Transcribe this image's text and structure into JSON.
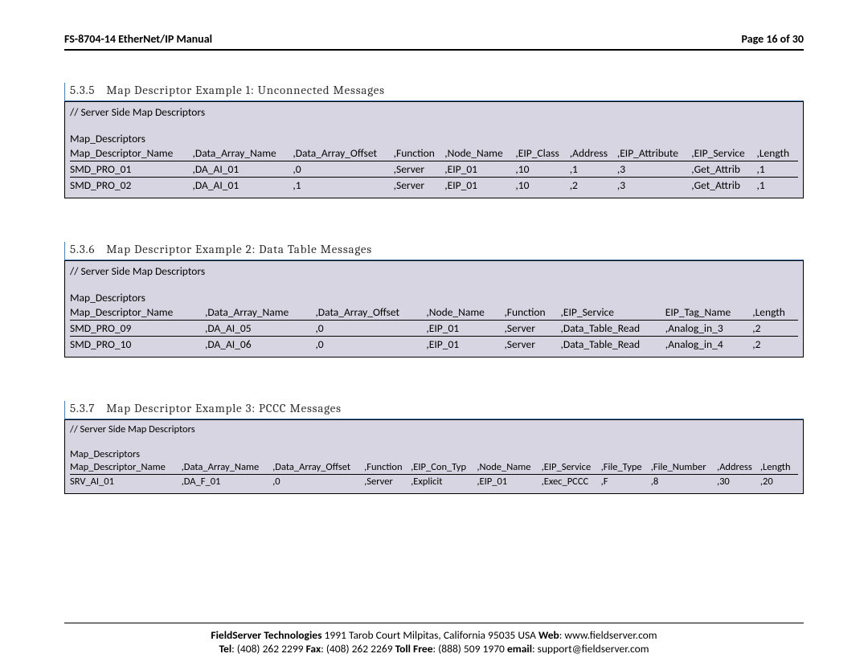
{
  "header": {
    "title": "FS-8704-14 EtherNet/IP Manual",
    "page": "Page 16 of 30"
  },
  "sections": [
    {
      "num": "5.3.5",
      "title": "Map Descriptor Example 1: Unconnected Messages",
      "comment": "// Server Side Map Descriptors",
      "label": "Map_Descriptors",
      "cols": [
        "Map_Descriptor_Name",
        ",Data_Array_Name",
        ",Data_Array_Offset",
        ",Function",
        ",Node_Name",
        ",EIP_Class",
        ",Address",
        ",EIP_Attribute",
        ",EIP_Service",
        ",Length"
      ],
      "rows": [
        [
          "SMD_PRO_01",
          ",DA_AI_01",
          ",0",
          ",Server",
          ",EIP_01",
          ",10",
          ",1",
          ",3",
          ",Get_Attrib",
          ",1"
        ],
        [
          "SMD_PRO_02",
          ",DA_AI_01",
          ",1",
          ",Server",
          ",EIP_01",
          ",10",
          ",2",
          ",3",
          ",Get_Attrib",
          ",1"
        ]
      ]
    },
    {
      "num": "5.3.6",
      "title": "Map Descriptor Example 2: Data Table Messages",
      "comment": "// Server Side Map Descriptors",
      "label": "Map_Descriptors",
      "cols": [
        "Map_Descriptor_Name",
        ",Data_Array_Name",
        ",Data_Array_Offset",
        ",Node_Name",
        ",Function",
        ",EIP_Service",
        "EIP_Tag_Name",
        ",Length"
      ],
      "rows": [
        [
          "SMD_PRO_09",
          ",DA_AI_05",
          ",0",
          ",EIP_01",
          ",Server",
          ",Data_Table_Read",
          ",Analog_in_3",
          ",2"
        ],
        [
          "SMD_PRO_10",
          ",DA_AI_06",
          ",0",
          ",EIP_01",
          ",Server",
          ",Data_Table_Read",
          ",Analog_in_4",
          ",2"
        ]
      ]
    },
    {
      "num": "5.3.7",
      "title": "Map Descriptor Example 3: PCCC Messages",
      "comment": "// Server Side Map Descriptors",
      "label": "Map_Descriptors",
      "cols": [
        "Map_Descriptor_Name",
        ",Data_Array_Name",
        ",Data_Array_Offset",
        ",Function",
        ",EIP_Con_Typ",
        ",Node_Name",
        ",EIP_Service",
        ",File_Type",
        ",File_Number",
        ",Address",
        ",Length"
      ],
      "rows": [
        [
          "SRV_AI_01",
          ",DA_F_01",
          ",0",
          ",Server",
          ",Explicit",
          ",EIP_01",
          ",Exec_PCCC",
          ",F",
          ",8",
          ",30",
          ",20"
        ]
      ]
    }
  ],
  "footer": {
    "l1a": "FieldServer Technologies",
    "l1b": " 1991 Tarob Court Milpitas, California 95035 USA  ",
    "l1c": "Web",
    "l1d": ": www.fieldserver.com",
    "l2a": "Tel",
    "l2b": ": (408) 262 2299  ",
    "l2c": "Fax",
    "l2d": ": (408) 262 2269  ",
    "l2e": "Toll Free",
    "l2f": ": (888) 509 1970   ",
    "l2g": "email",
    "l2h": ": support@fieldserver.com"
  }
}
